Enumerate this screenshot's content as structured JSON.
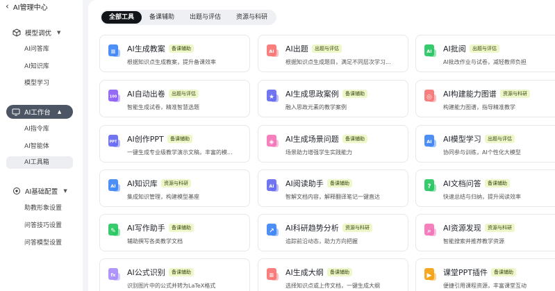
{
  "app": {
    "title": "AI管理中心",
    "back_icon": "chevron-left-icon"
  },
  "sidebar": {
    "groups": [
      {
        "label": "模型调优",
        "icon": "cube-icon",
        "items": [
          "AI问答库",
          "AI知识库",
          "模型学习"
        ]
      },
      {
        "label": "AI工作台",
        "icon": "workbench-icon",
        "items": [
          "AI指令库",
          "AI智能体",
          "AI工具箱"
        ],
        "active": true,
        "selected_item": "AI工具箱"
      },
      {
        "label": "AI基础配置",
        "icon": "settings-icon",
        "items": [
          "助教形象设置",
          "问答技巧设置",
          "问答模型设置"
        ]
      }
    ]
  },
  "tabs": [
    {
      "label": "全部工具",
      "active": true
    },
    {
      "label": "备课辅助",
      "active": false
    },
    {
      "label": "出题与评估",
      "active": false
    },
    {
      "label": "资源与科研",
      "active": false
    }
  ],
  "colors": {
    "badge_bg": "#eef7c9",
    "active_tab": "#111418",
    "sidebar_active": "#4b5563"
  },
  "tools": [
    {
      "name": "AI生成教案",
      "tag": "备课辅助",
      "desc": "根据知识点生成教案，提升备课效率",
      "icon": "lesson-plan-icon",
      "color": "#3b82f6"
    },
    {
      "name": "AI出题",
      "tag": "出题与评估",
      "desc": "根据知识点生成题目，满足不同层次学习...",
      "icon": "question-icon",
      "color": "#f87171"
    },
    {
      "name": "AI批阅",
      "tag": "出题与评估",
      "desc": "AI批改作业与试卷，减轻教师负担",
      "icon": "grading-icon",
      "color": "#22c55e"
    },
    {
      "name": "AI自动出卷",
      "tag": "出题与评估",
      "desc": "智能生成试卷，精准智慧选题",
      "icon": "exam-paper-icon",
      "color": "#8b5cf6"
    },
    {
      "name": "AI生成思政案例",
      "tag": "备课辅助",
      "desc": "融入思政元素的教学案例",
      "icon": "star-doc-icon",
      "color": "#6366f1"
    },
    {
      "name": "AI构建能力图谱",
      "tag": "资源与科研",
      "desc": "构建能力图谱，指导精准教学",
      "icon": "ability-map-icon",
      "color": "#f87171"
    },
    {
      "name": "AI创作PPT",
      "tag": "备课辅助",
      "desc": "一键生成专业级教学演示文稿，丰富的模...",
      "icon": "ppt-icon",
      "color": "#6366f1"
    },
    {
      "name": "AI生成场景问题",
      "tag": "备课辅助",
      "desc": "场景助力增强学生实践能力",
      "icon": "layers-icon",
      "color": "#f472b6"
    },
    {
      "name": "AI模型学习",
      "tag": "出题与评估",
      "desc": "协同参与训练，AI个性化大模型",
      "icon": "model-cube-icon",
      "color": "#3b82f6"
    },
    {
      "name": "AI知识库",
      "tag": "资源与科研",
      "desc": "集成知识管理，构建模型基座",
      "icon": "knowledge-base-icon",
      "color": "#3b82f6"
    },
    {
      "name": "AI阅读助手",
      "tag": "备课辅助",
      "desc": "智解文档内容，解释翻译笔记一键直达",
      "icon": "reader-icon",
      "color": "#6366f1"
    },
    {
      "name": "AI文档问答",
      "tag": "备课辅助",
      "desc": "快速总结与归纳，提升阅读效率",
      "icon": "doc-qa-icon",
      "color": "#22c55e"
    },
    {
      "name": "AI写作助手",
      "tag": "备课辅助",
      "desc": "辅助撰写各类教学文档",
      "icon": "writing-icon",
      "color": "#22c55e"
    },
    {
      "name": "AI科研趋势分析",
      "tag": "资源与科研",
      "desc": "追踪前沿动态，助力方向把握",
      "icon": "trend-icon",
      "color": "#3b82f6"
    },
    {
      "name": "AI资源发现",
      "tag": "资源与科研",
      "desc": "智能搜索并推荐教学资源",
      "icon": "resource-search-icon",
      "color": "#f472b6"
    },
    {
      "name": "AI公式识别",
      "tag": "备课辅助",
      "desc": "识别图片中的公式并转为LaTeX格式",
      "icon": "formula-icon",
      "color": "#a78bfa"
    },
    {
      "name": "AI生成大纲",
      "tag": "备课辅助",
      "desc": "选择知识点或上传文档，一键生成大纲",
      "icon": "outline-icon",
      "color": "#f87171"
    },
    {
      "name": "课堂PPT插件",
      "tag": "备课辅助",
      "desc": "便捷引用课程资源，丰富课堂互动",
      "icon": "ppt-plugin-icon",
      "color": "#f59e0b"
    }
  ]
}
